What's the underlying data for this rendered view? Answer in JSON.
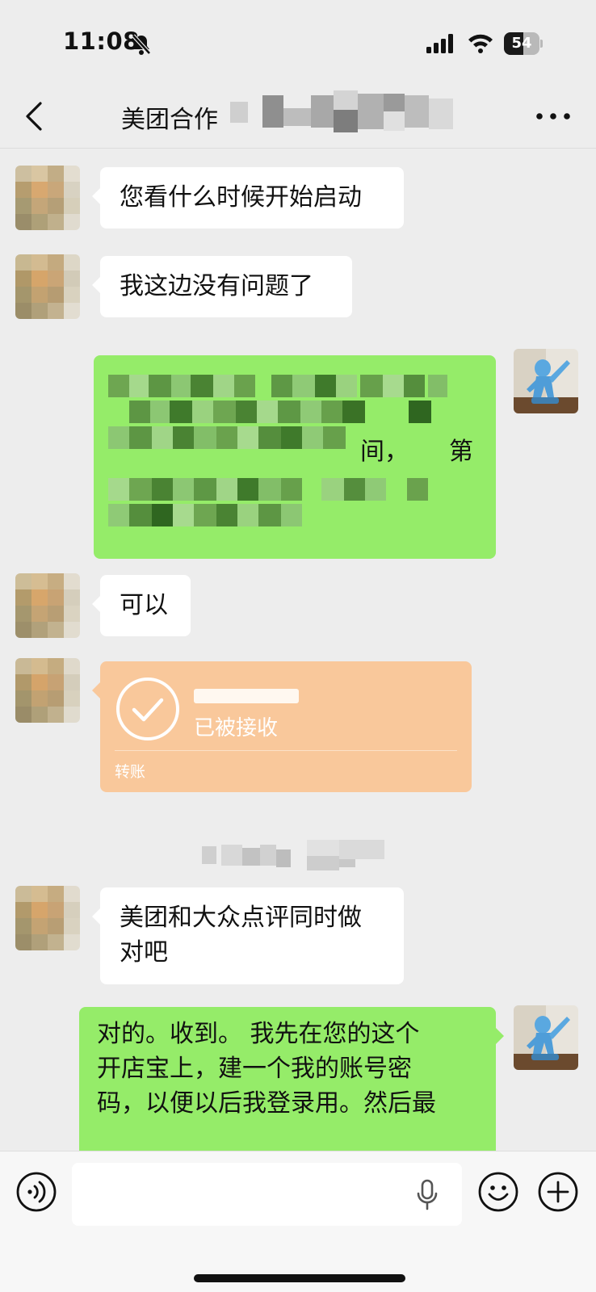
{
  "status_bar": {
    "time": "11:08",
    "battery_level": "54",
    "icons": [
      "bell-slash-icon",
      "signal-icon",
      "wifi-icon",
      "battery-icon"
    ]
  },
  "nav": {
    "title": "美团合作",
    "back_icon": "chevron-left-icon",
    "more_icon": "more-dots-icon"
  },
  "messages": [
    {
      "side": "left",
      "text": "您看什么时候开始启动"
    },
    {
      "side": "left",
      "text": "我这边没有问题了"
    },
    {
      "side": "right",
      "visible_fragments": [
        "间，",
        "第"
      ]
    },
    {
      "side": "left",
      "text": "可以"
    },
    {
      "side": "left",
      "type": "transfer",
      "status": "已被接收",
      "label": "转账"
    },
    {
      "side": "left",
      "text_lines": [
        "美团和大众点评同时做",
        "对吧"
      ]
    },
    {
      "side": "right",
      "text_lines": [
        "对的。收到。 我先在您的这个",
        "开店宝上，建一个我的账号密",
        "码，以便以后我登录用。然后最"
      ]
    }
  ],
  "input_bar": {
    "icons": [
      "voice-icon",
      "mic-icon",
      "emoji-icon",
      "plus-icon"
    ]
  },
  "colors": {
    "background": "#ededed",
    "bubble_self": "#95ec69",
    "bubble_other": "#ffffff",
    "transfer_card": "#f9c89b",
    "input_bar": "#f7f7f7"
  }
}
